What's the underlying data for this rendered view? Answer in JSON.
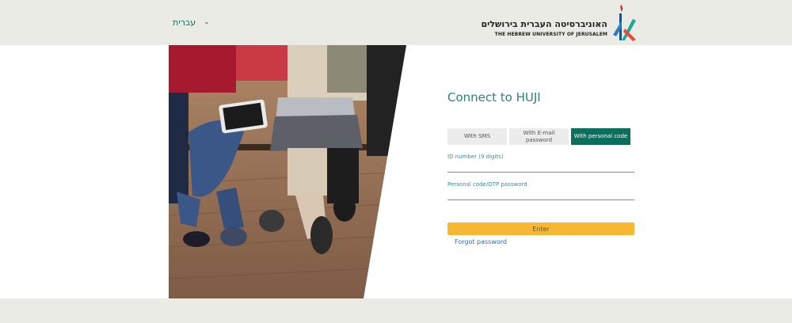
{
  "header": {
    "language_label": "עברית",
    "logo_hebrew": "האוניברסיטה העברית בירושלים",
    "logo_english": "THE HEBREW UNIVERSITY OF JERUSALEM"
  },
  "login": {
    "title": "Connect to HUJI",
    "tabs": [
      {
        "label": "With SMS",
        "active": false
      },
      {
        "label": "With E-mail password",
        "active": false
      },
      {
        "label": "With personal code",
        "active": true
      }
    ],
    "id_label": "ID number (9 digits)",
    "id_value": "",
    "code_label": "Personal code/OTP password",
    "code_value": "",
    "enter_label": "Enter",
    "forgot_label": "Forgot password"
  },
  "colors": {
    "header_bg": "#ebebe6",
    "accent_green": "#0e6e5c",
    "title_teal": "#2e7e8a",
    "enter_yellow": "#f7b733",
    "link_blue": "#2b68c6"
  }
}
